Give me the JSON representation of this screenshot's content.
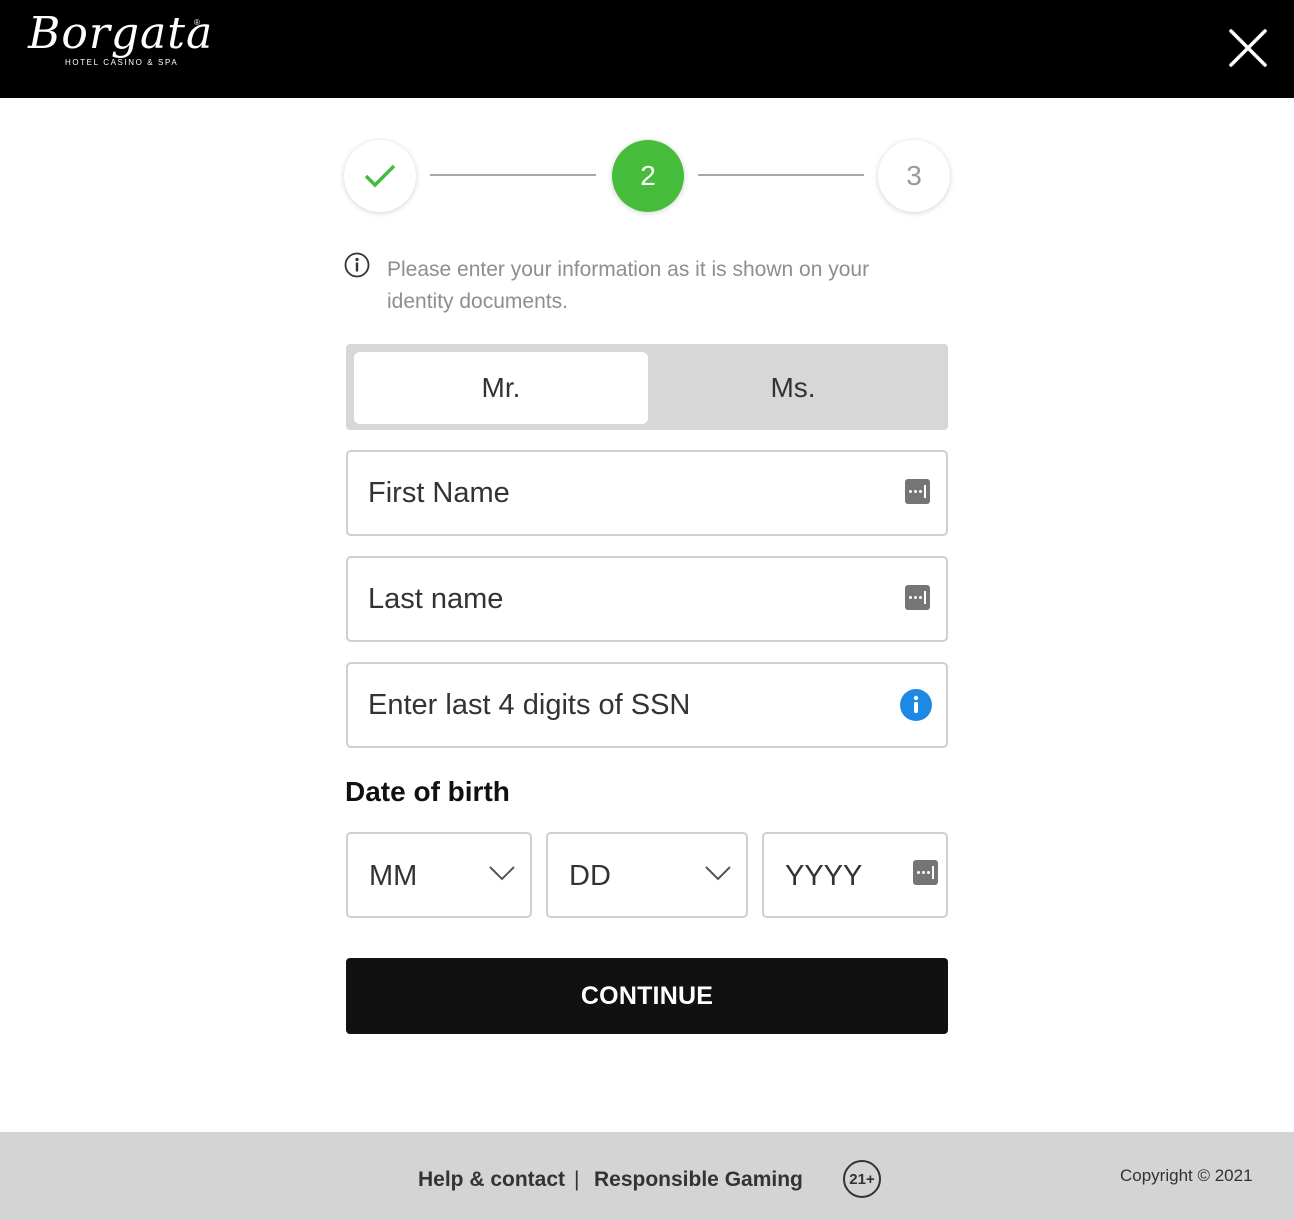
{
  "header": {
    "logo": {
      "brand": "Borgata",
      "registered": "®",
      "subtitle": "HOTEL  CASINO & SPA"
    },
    "close_icon": "close-icon"
  },
  "stepper": {
    "steps": [
      {
        "label": "✓",
        "state": "completed",
        "icon": "check-icon"
      },
      {
        "label": "2",
        "state": "active"
      },
      {
        "label": "3",
        "state": "pending"
      }
    ],
    "colors": {
      "active": "#45bd3b",
      "pending_text": "#9a9a9a"
    }
  },
  "info": {
    "icon": "info-circle-icon",
    "text": "Please enter your information as it is shown on your identity documents."
  },
  "title_toggle": {
    "options": [
      {
        "label": "Mr.",
        "selected": true
      },
      {
        "label": "Ms.",
        "selected": false
      }
    ]
  },
  "fields": {
    "first_name": {
      "placeholder": "First Name",
      "value": "",
      "icon": "keyboard-icon"
    },
    "last_name": {
      "placeholder": "Last name",
      "value": "",
      "icon": "keyboard-icon"
    },
    "ssn": {
      "placeholder": "Enter last 4 digits of SSN",
      "value": "",
      "icon": "info-icon"
    }
  },
  "dob": {
    "label": "Date of birth",
    "month": {
      "value": "MM",
      "icon": "chevron-down-icon"
    },
    "day": {
      "value": "DD",
      "icon": "chevron-down-icon"
    },
    "year": {
      "value": "YYYY",
      "icon": "keyboard-icon"
    }
  },
  "continue_button": {
    "label": "CONTINUE"
  },
  "footer": {
    "help_link": "Help & contact",
    "separator": "|",
    "responsible_gaming_link": "Responsible Gaming",
    "age_badge": "21+",
    "copyright": "Copyright © 2021"
  }
}
